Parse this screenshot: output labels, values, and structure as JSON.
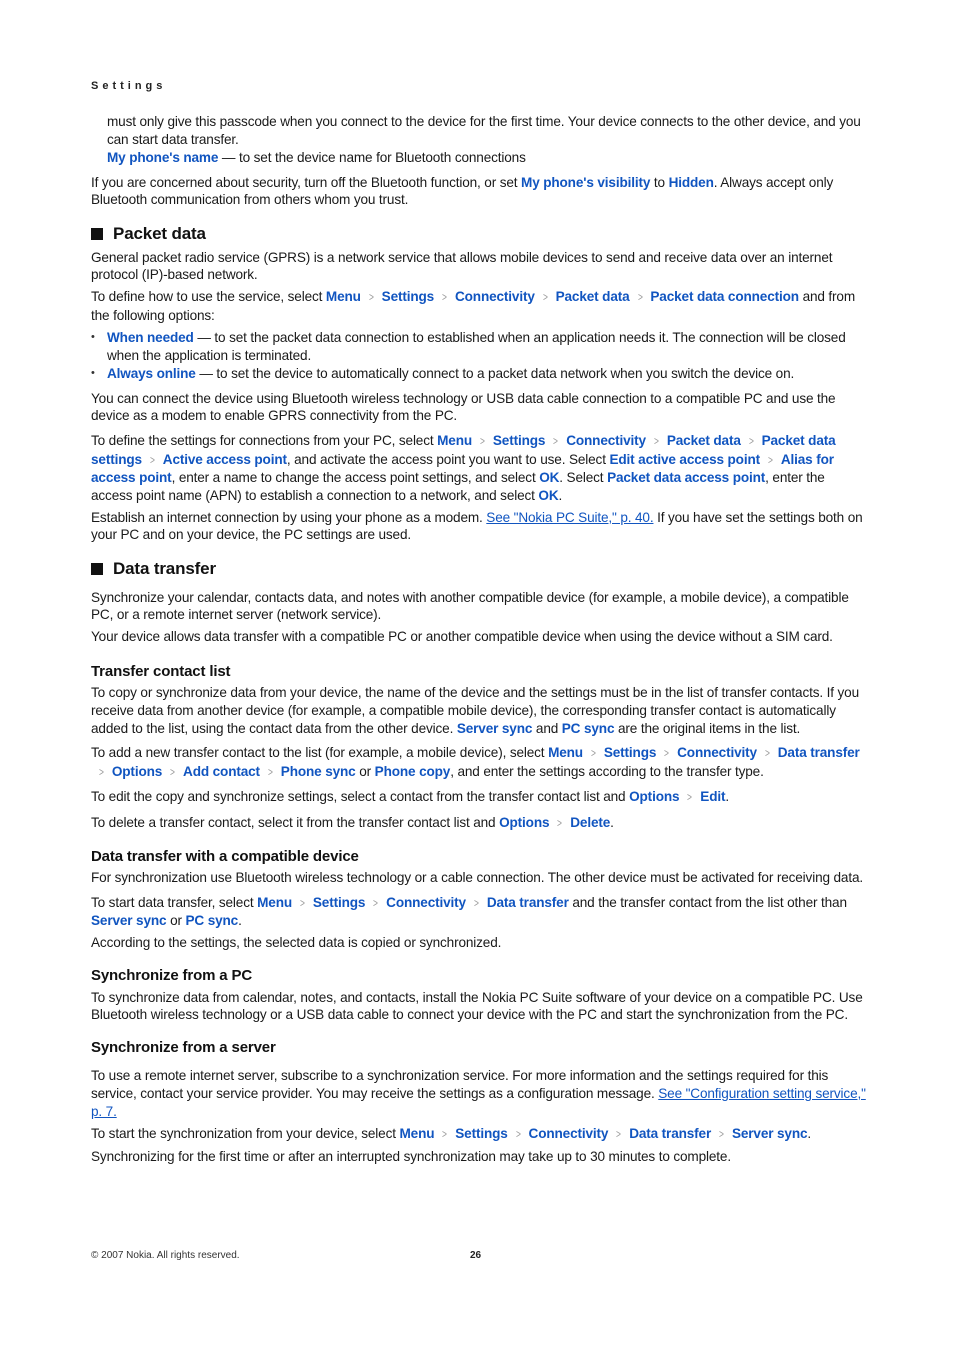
{
  "running_head": "Settings",
  "intro": {
    "bullet_continuation": "must only give this passcode when you connect to the device for the first time. Your device connects to the other device, and you can start data transfer.",
    "bullet_my_phone_name": {
      "key": "My phone's name",
      "text": " — to set the device name for Bluetooth connections"
    },
    "security_para": {
      "t1": "If you are concerned about security, turn off the Bluetooth function, or set ",
      "k1": "My phone's visibility",
      "t2": " to ",
      "k2": "Hidden",
      "t3": ". Always accept only Bluetooth communication from others whom you trust."
    }
  },
  "packet_data": {
    "heading": "Packet data",
    "p1": "General packet radio service (GPRS) is a network service that allows mobile devices to send and receive data over an internet protocol (IP)-based network.",
    "p2": {
      "t1": "To define how to use the service, select ",
      "path": [
        "Menu",
        "Settings",
        "Connectivity",
        "Packet data",
        "Packet data connection"
      ],
      "t2": " and from the following options:"
    },
    "options": [
      {
        "key": "When needed",
        "text": " — to set the packet data connection to established when an application needs it. The connection will be closed when the application is terminated."
      },
      {
        "key": "Always online",
        "text": " — to set the device to automatically connect to a packet data network when you switch the device on."
      }
    ],
    "p3": "You can connect the device using Bluetooth wireless technology or USB data cable connection to a compatible PC and use the device as a modem to enable GPRS connectivity from the PC.",
    "p4": {
      "t1": "To define the settings for connections from your PC, select ",
      "path": [
        "Menu",
        "Settings",
        "Connectivity",
        "Packet data",
        "Packet data settings",
        "Active access point"
      ],
      "t2": ", and activate the access point you want to use. Select ",
      "path2": [
        "Edit active access point",
        "Alias for access point"
      ],
      "t3": ", enter a name to change the access point settings, and select ",
      "k_ok1": "OK",
      "t4": ". Select ",
      "k_pdap": "Packet data access point",
      "t5": ", enter the access point name (APN) to establish a connection to a network, and select ",
      "k_ok2": "OK",
      "t6": "."
    },
    "p5": {
      "t1": "Establish an internet connection by using your phone as a modem. ",
      "link": "See \"Nokia PC Suite,\" p. 40.",
      "t2": " If you have set the settings both on your PC and on your device, the PC settings are used."
    }
  },
  "data_transfer": {
    "heading": "Data transfer",
    "p1": "Synchronize your calendar, contacts data, and notes with another compatible device (for example, a mobile device), a compatible PC, or a remote internet server (network service).",
    "p2": "Your device allows data transfer with a compatible PC or another compatible device when using the device without a SIM card.",
    "contact_list": {
      "heading": "Transfer contact list",
      "p1": {
        "t1": "To copy or synchronize data from your device, the name of the device and the settings must be in the list of transfer contacts. If you receive data from another device (for example, a compatible mobile device), the corresponding transfer contact is automatically added to the list, using the contact data from the other device. ",
        "k1": "Server sync",
        "t2": " and ",
        "k2": "PC sync",
        "t3": " are the original items in the list."
      },
      "p2": {
        "t1": "To add a new transfer contact to the list (for example, a mobile device), select ",
        "path": [
          "Menu",
          "Settings",
          "Connectivity",
          "Data transfer",
          "Options",
          "Add contact",
          "Phone sync"
        ],
        "t2": " or ",
        "k1": "Phone copy",
        "t3": ", and enter the settings according to the transfer type."
      },
      "p3": {
        "t1": "To edit the copy and synchronize settings, select a contact from the transfer contact list and ",
        "path": [
          "Options",
          "Edit"
        ],
        "t2": "."
      },
      "p4": {
        "t1": "To delete a transfer contact, select it from the transfer contact list and ",
        "path": [
          "Options",
          "Delete"
        ],
        "t2": "."
      }
    },
    "compatible_device": {
      "heading": "Data transfer with a compatible device",
      "p1": "For synchronization use Bluetooth wireless technology or a cable connection. The other device must be activated for receiving data.",
      "p2": {
        "t1": "To start data transfer, select ",
        "path": [
          "Menu",
          "Settings",
          "Connectivity",
          "Data transfer"
        ],
        "t2": " and the transfer contact from the list other than ",
        "k1": "Server sync",
        "t3": " or ",
        "k2": "PC sync",
        "t4": "."
      },
      "p3": "According to the settings, the selected data is copied or synchronized."
    },
    "sync_pc": {
      "heading": "Synchronize from a PC",
      "p1": "To synchronize data from calendar, notes, and contacts, install the Nokia PC Suite software of your device on a compatible PC. Use Bluetooth wireless technology or a USB data cable to connect your device with the PC and start the synchronization from the PC."
    },
    "sync_server": {
      "heading": "Synchronize from a server",
      "p1": {
        "t1": "To use a remote internet server, subscribe to a synchronization service. For more information and the settings required for this service, contact your service provider. You may receive the settings as a configuration message. ",
        "link": "See \"Configuration setting service,\" p. 7."
      },
      "p2": {
        "t1": "To start the synchronization from your device, select ",
        "path": [
          "Menu",
          "Settings",
          "Connectivity",
          "Data transfer",
          "Server sync"
        ],
        "t2": "."
      },
      "p3": "Synchronizing for the first time or after an interrupted synchronization may take up to 30 minutes to complete."
    }
  },
  "footer": {
    "copyright": "© 2007 Nokia. All rights reserved.",
    "page_number": "26"
  },
  "colors": {
    "link": "#1155c0",
    "chevron": "#9a9a9a",
    "text": "#1a1a1a"
  },
  "icons": {
    "path_separator": "chevron-right-icon",
    "heading_marker": "square-icon"
  }
}
